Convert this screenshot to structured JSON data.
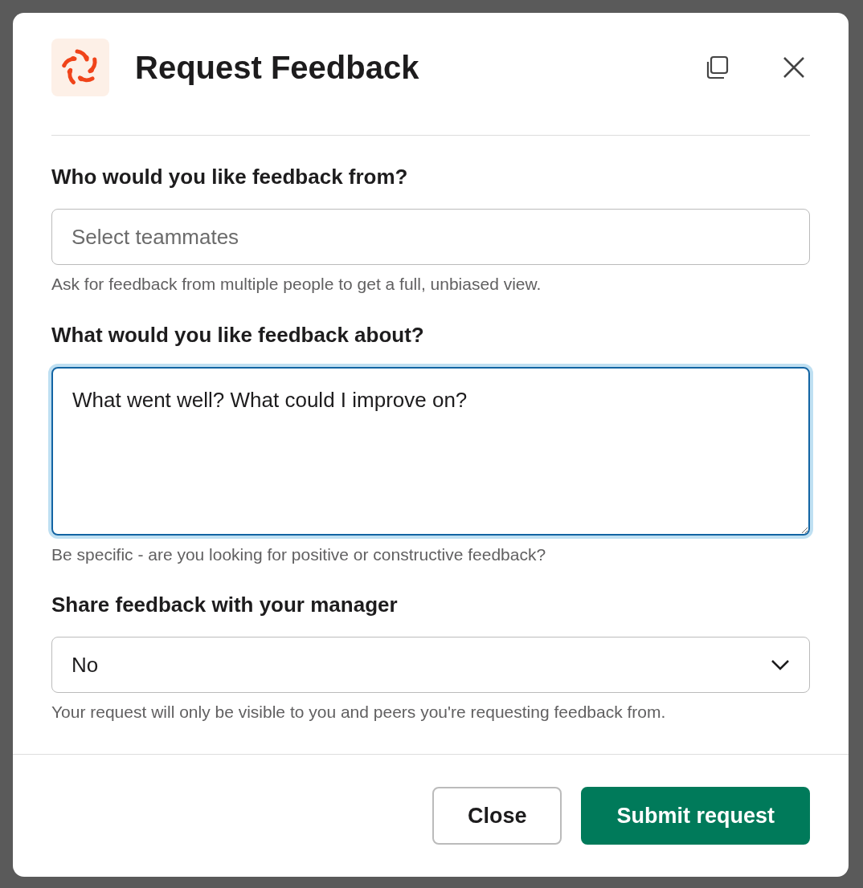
{
  "modal": {
    "title": "Request Feedback",
    "fields": [
      {
        "kind": "select_multi",
        "label": "Who would you like feedback from?",
        "placeholder": "Select teammates",
        "hint": "Ask for feedback from multiple people to get a full, unbiased view.",
        "focused": false
      },
      {
        "kind": "textarea",
        "label": "What would you like feedback about?",
        "value": "What went well? What could I improve on?",
        "hint": "Be specific - are you looking for positive or constructive feedback?",
        "focused": true
      },
      {
        "kind": "dropdown",
        "label": "Share feedback with your manager",
        "value": "No",
        "hint": "Your request will only be visible to you and peers you're requesting feedback from.",
        "focused": false
      }
    ],
    "buttons": [
      {
        "label": "Close",
        "kind": "secondary"
      },
      {
        "label": "Submit request",
        "kind": "primary"
      }
    ]
  }
}
